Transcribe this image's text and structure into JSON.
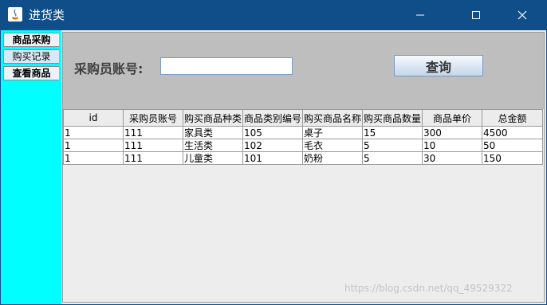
{
  "window": {
    "title": "进货类",
    "controls": [
      "minimize-icon",
      "maximize-icon",
      "close-icon"
    ]
  },
  "tabs": [
    {
      "label": "商品采购",
      "selected": false
    },
    {
      "label": "购买记录",
      "selected": true
    },
    {
      "label": "查看商品",
      "selected": false
    }
  ],
  "search": {
    "label": "采购员账号:",
    "value": "",
    "button_label": "查询"
  },
  "table": {
    "columns": [
      "id",
      "采购员账号",
      "购买商品种类",
      "商品类别编号",
      "购买商品名称",
      "购买商品数量",
      "商品单价",
      "总金额"
    ],
    "rows": [
      [
        "1",
        "111",
        "家具类",
        "105",
        "桌子",
        "15",
        "300",
        "4500"
      ],
      [
        "1",
        "111",
        "生活类",
        "102",
        "毛衣",
        "5",
        "10",
        "50"
      ],
      [
        "1",
        "111",
        "儿童类",
        "101",
        "奶粉",
        "5",
        "30",
        "150"
      ]
    ]
  },
  "watermark": "https://blog.csdn.net/qq_49529322",
  "colors": {
    "titlebar": "#0f4e88",
    "tab_strip": "#00ffff",
    "top_panel": "#bebebe"
  }
}
